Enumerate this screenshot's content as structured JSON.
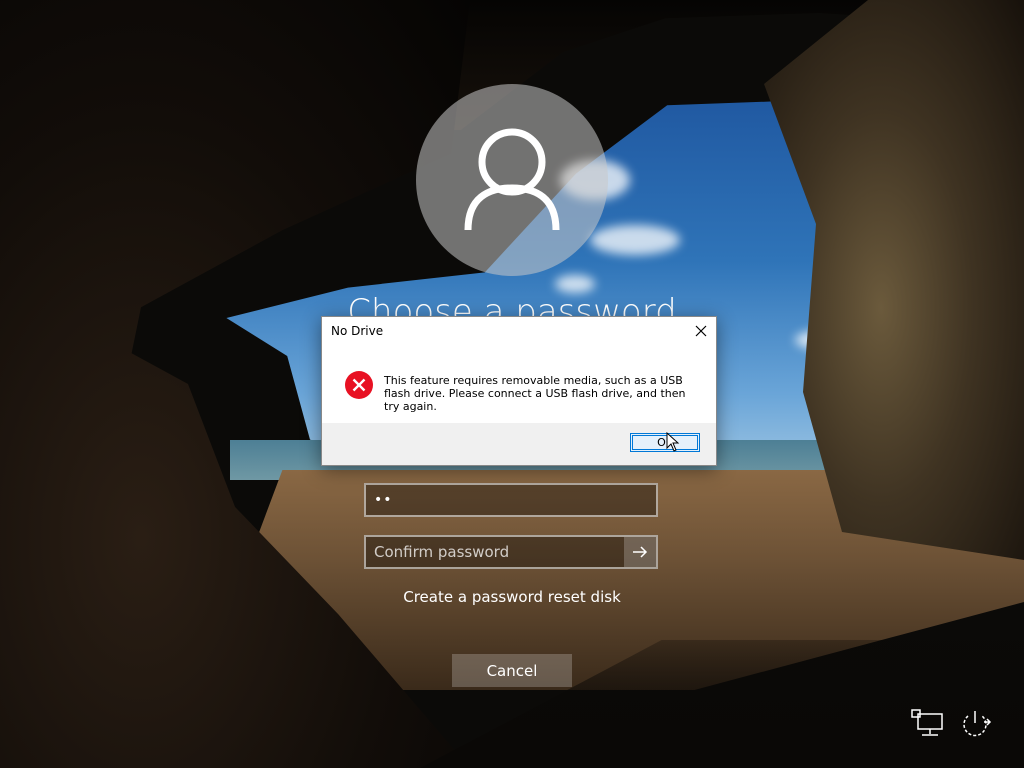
{
  "screen": {
    "heading": "Choose a password",
    "password_field": {
      "value_masked": "••"
    },
    "confirm_field": {
      "placeholder": "Confirm password"
    },
    "reset_link": "Create a password reset disk",
    "cancel_label": "Cancel"
  },
  "dialog": {
    "title": "No Drive",
    "message": "This feature requires removable media, such as a USB flash drive. Please connect a USB flash drive, and then try again.",
    "ok_label": "OK",
    "icon": "error-icon"
  },
  "tray": {
    "network_icon": "network-icon",
    "power_icon": "power-icon"
  },
  "colors": {
    "error_red": "#e81123",
    "focus_blue": "#0078d7"
  }
}
